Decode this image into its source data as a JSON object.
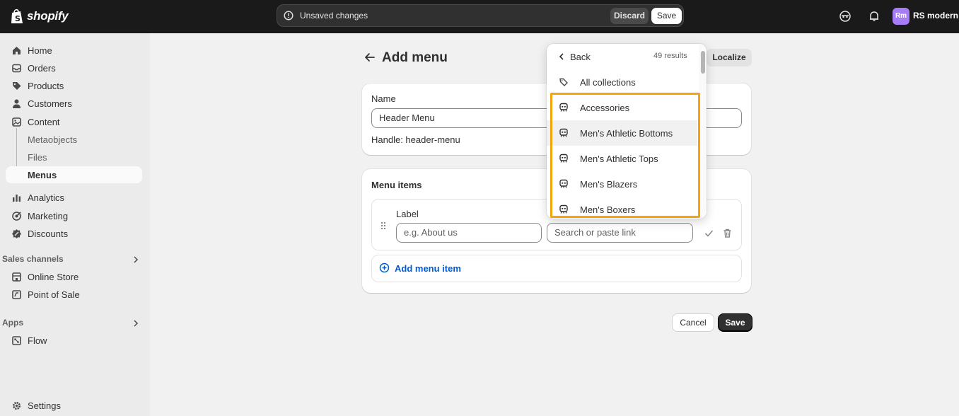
{
  "topbar": {
    "brand": "shopify",
    "unsaved_text": "Unsaved changes",
    "discard_label": "Discard",
    "save_label": "Save",
    "avatar_initials": "Rm",
    "store_name": "RS modern"
  },
  "sidebar": {
    "items": [
      {
        "label": "Home",
        "icon": "home-icon"
      },
      {
        "label": "Orders",
        "icon": "orders-icon"
      },
      {
        "label": "Products",
        "icon": "products-tag-icon"
      },
      {
        "label": "Customers",
        "icon": "person-icon"
      },
      {
        "label": "Content",
        "icon": "content-icon"
      },
      {
        "label": "Metaobjects"
      },
      {
        "label": "Files"
      },
      {
        "label": "Menus"
      },
      {
        "label": "Analytics",
        "icon": "analytics-icon"
      },
      {
        "label": "Marketing",
        "icon": "marketing-icon"
      },
      {
        "label": "Discounts",
        "icon": "discount-icon"
      }
    ],
    "sales_channels_label": "Sales channels",
    "sales_channels": [
      {
        "label": "Online Store",
        "icon": "store-icon"
      },
      {
        "label": "Point of Sale",
        "icon": "pos-icon"
      }
    ],
    "apps_label": "Apps",
    "apps": [
      {
        "label": "Flow",
        "icon": "flow-icon"
      }
    ],
    "settings_label": "Settings"
  },
  "page": {
    "title": "Add menu",
    "localize_label": "Localize",
    "name_label": "Name",
    "name_value": "Header Menu",
    "handle_text": "Handle: header-menu",
    "menu_items_title": "Menu items",
    "label_field_label": "Label",
    "label_placeholder": "e.g. About us",
    "link_placeholder": "Search or paste link",
    "add_item_label": "Add menu item",
    "cancel_label": "Cancel",
    "save_label": "Save"
  },
  "dropdown": {
    "back_label": "Back",
    "results_text": "49 results",
    "all_collections_label": "All collections",
    "collections": [
      "Accessories",
      "Men's Athletic Bottoms",
      "Men's Athletic Tops",
      "Men's Blazers",
      "Men's Boxers"
    ]
  },
  "colors": {
    "topbar": "#1a1a1a",
    "highlight": "#f5a30e",
    "link_blue": "#005bd3",
    "avatar": "#a77cf7"
  }
}
